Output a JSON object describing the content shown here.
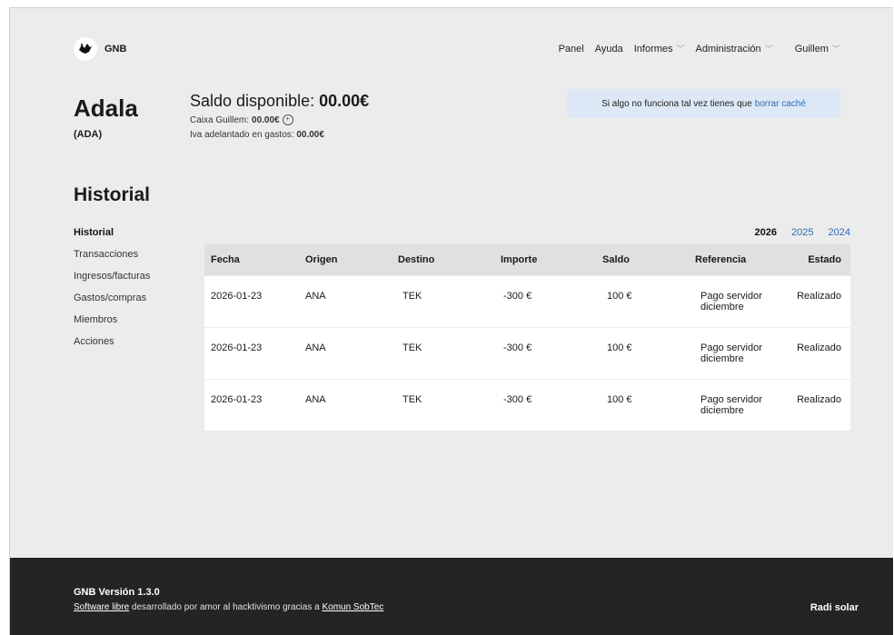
{
  "brand": {
    "name": "GNB",
    "logo_icon": "gnb-bird-logo"
  },
  "nav": {
    "items": [
      {
        "label": "Panel"
      },
      {
        "label": "Ayuda"
      },
      {
        "label": "Informes",
        "icon": "chevron-down-icon"
      },
      {
        "label": "Administración",
        "icon": "chevron-down-icon"
      },
      {
        "label": "Guillem",
        "icon": "chevron-down-icon"
      }
    ]
  },
  "entity": {
    "name": "Adala",
    "code": "(ADA)"
  },
  "balance": {
    "title": "Saldo disponible:",
    "amount": "00.00€",
    "caixa_label": "Caixa Guillem:",
    "caixa_amount": "00.00€",
    "iva_label": "Iva adelantado en gastos:",
    "iva_amount": "00.00€"
  },
  "notice": {
    "text": "Si algo no funciona tal vez tienes que",
    "link": "borrar caché"
  },
  "section_title": "Historial",
  "sidebar": {
    "items": [
      {
        "label": "Historial",
        "active": true
      },
      {
        "label": "Transacciones"
      },
      {
        "label": "Ingresos/facturas"
      },
      {
        "label": "Gastos/compras"
      },
      {
        "label": "Miembros"
      },
      {
        "label": "Acciones"
      }
    ]
  },
  "years": {
    "current": "2026",
    "others": [
      "2025",
      "2024"
    ]
  },
  "table": {
    "headers": [
      "Fecha",
      "Origen",
      "Destino",
      "Importe",
      "Saldo",
      "Referencia",
      "Estado"
    ],
    "rows": [
      [
        "2026-01-23",
        "ANA",
        "TEK",
        "-300 €",
        "100 €",
        "Pago servidor diciembre",
        "Realizado"
      ],
      [
        "2026-01-23",
        "ANA",
        "TEK",
        "-300 €",
        "100 €",
        "Pago servidor diciembre",
        "Realizado"
      ],
      [
        "2026-01-23",
        "ANA",
        "TEK",
        "-300 €",
        "100 €",
        "Pago servidor diciembre",
        "Realizado"
      ]
    ]
  },
  "footer": {
    "version": "GNB Versión 1.3.0",
    "link1": "Software libre",
    "middle": "desarrollado por amor al hacktivismo gracias a",
    "link2": "Komun SobTec",
    "right": "Radi solar"
  },
  "colors": {
    "link": "#2a6db5",
    "notice_bg": "#dde8f6",
    "footer_bg": "#262323",
    "page_bg": "#ececed"
  }
}
